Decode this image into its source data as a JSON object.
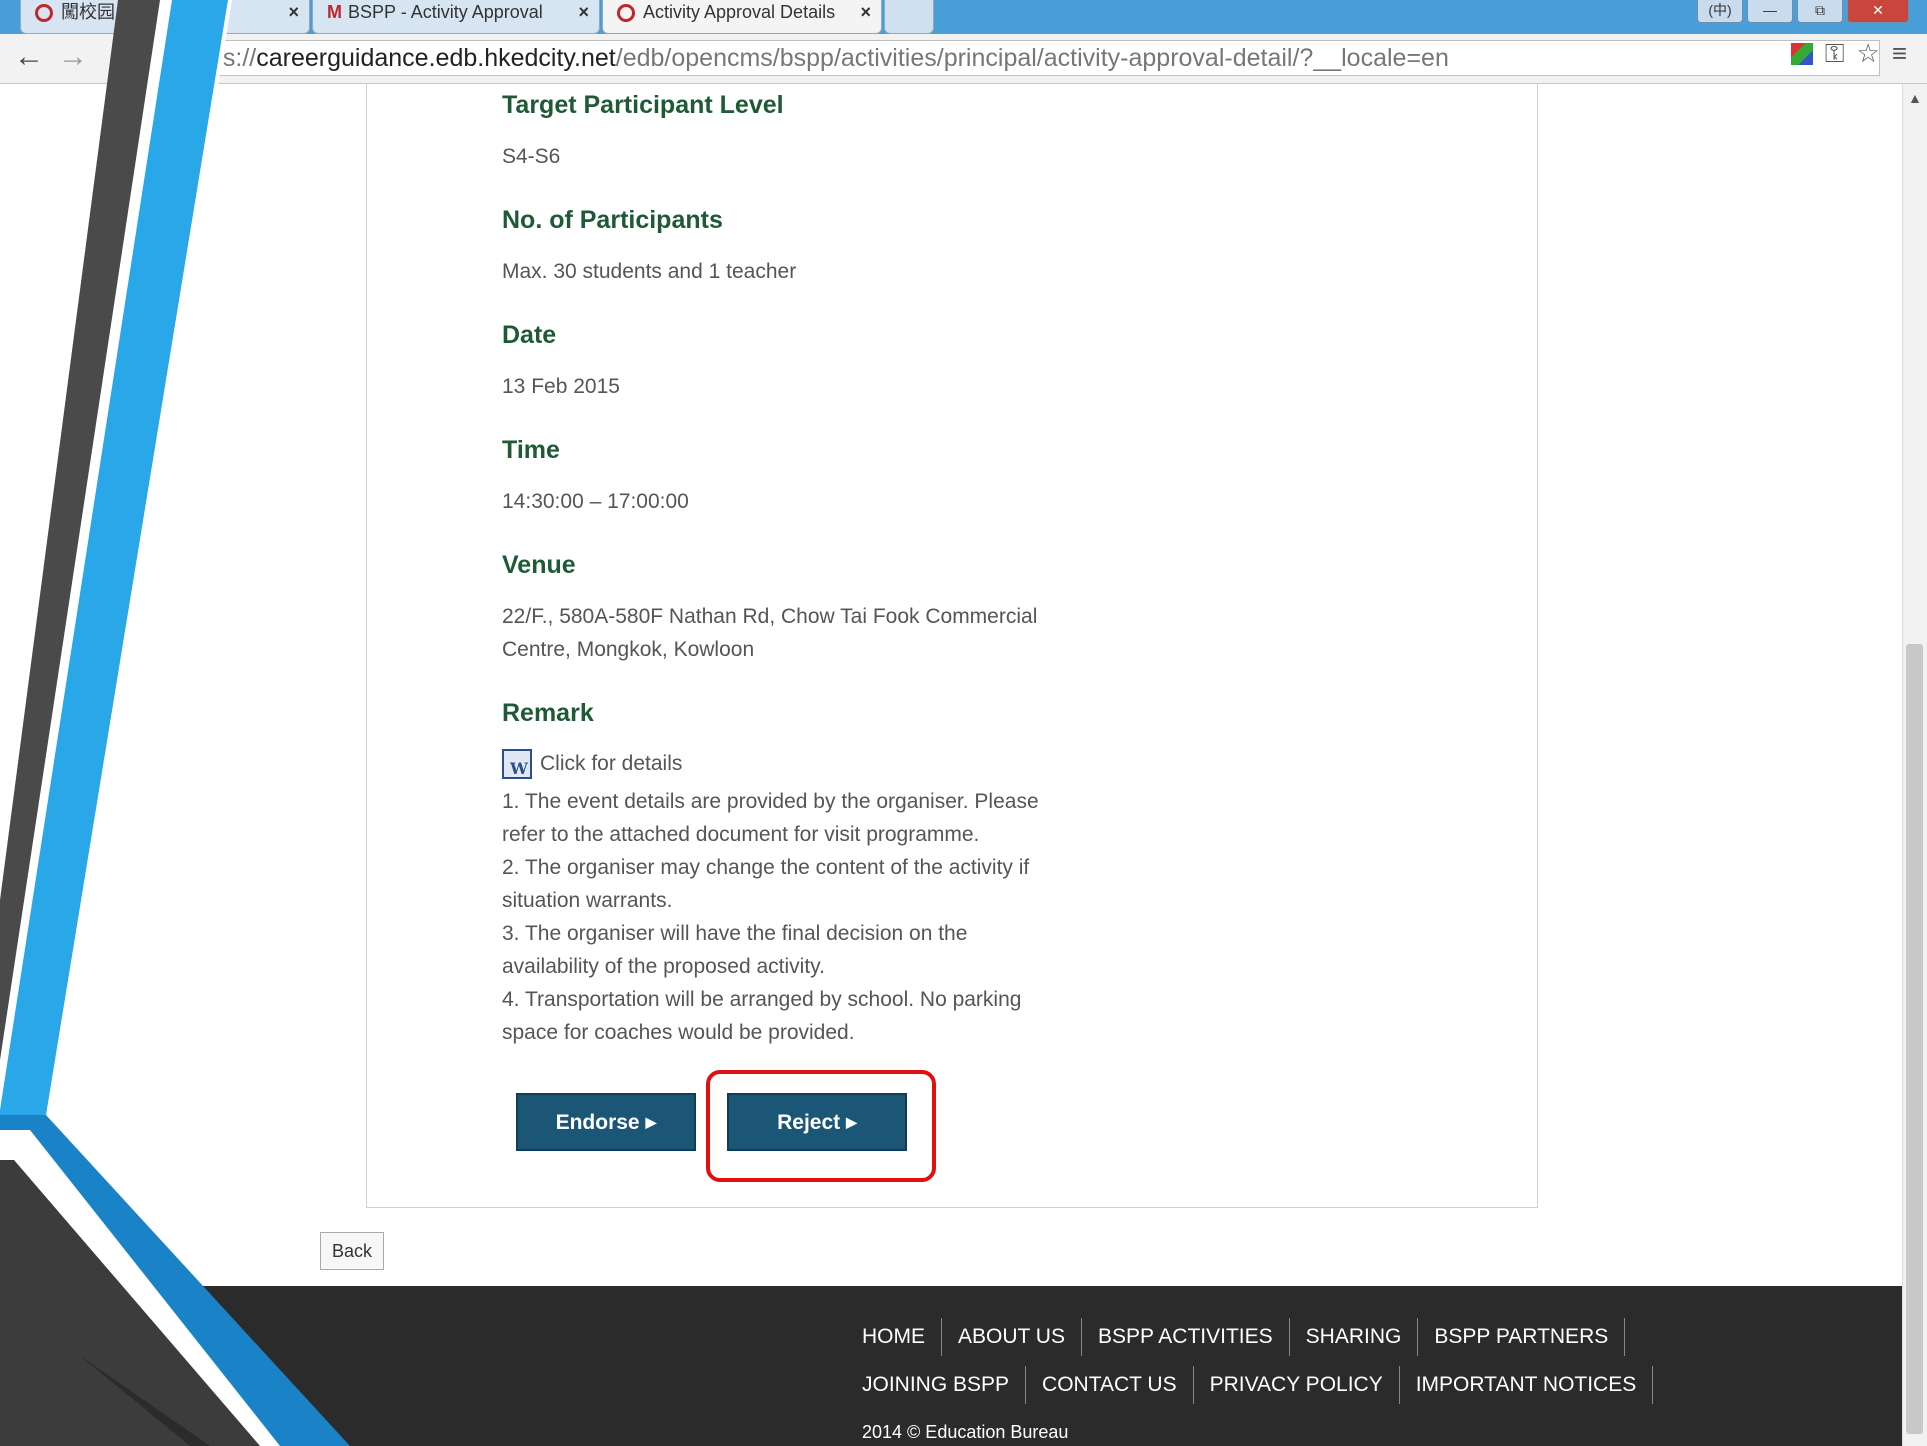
{
  "browser": {
    "tabs": [
      {
        "label": "闖校园..."
      },
      {
        "label": "BSPP - Activity Approval"
      },
      {
        "label": "Activity Approval Details"
      }
    ],
    "url_prefix": "ps://",
    "url_host": "careerguidance.edb.hkedcity.net",
    "url_path": "/edb/opencms/bspp/activities/principal/activity-approval-detail/?__locale=en",
    "back_arrow": "←",
    "forward_arrow": "→",
    "window_buttons": [
      "(中)",
      "—",
      "⧉",
      "✕"
    ]
  },
  "details": {
    "target_label": "Target Participant Level",
    "target_value": "S4-S6",
    "participants_label": "No. of Participants",
    "participants_value": "Max. 30 students and 1 teacher",
    "date_label": "Date",
    "date_value": "13 Feb 2015",
    "time_label": "Time",
    "time_value": "14:30:00 – 17:00:00",
    "venue_label": "Venue",
    "venue_line1": "22/F., 580A-580F Nathan Rd, Chow Tai Fook Commercial",
    "venue_line2": "Centre, Mongkok, Kowloon",
    "remark_label": "Remark",
    "remark_link": "Click for details",
    "remark_lines": [
      "1. The event details are provided by the organiser. Please",
      "refer to the attached document for visit programme.",
      "2. The organiser may change the content of the activity if",
      "situation warrants.",
      "3. The organiser will have the final decision on the",
      "availability of the proposed activity.",
      "4. Transportation will be arranged by school. No parking",
      "space for coaches would be provided."
    ]
  },
  "actions": {
    "endorse_label": "Endorse",
    "reject_label": "Reject",
    "arrow": "▶",
    "back_label": "Back"
  },
  "footer": {
    "nav_row1": [
      "HOME",
      "ABOUT US",
      "BSPP ACTIVITIES",
      "SHARING",
      "BSPP PARTNERS"
    ],
    "nav_row2": [
      "JOINING BSPP",
      "CONTACT US",
      "PRIVACY POLICY",
      "IMPORTANT NOTICES"
    ],
    "copyright": "2014 © Education Bureau"
  },
  "colors": {
    "label_green": "#1e5a36",
    "button_blue": "#1b5677",
    "highlight_red": "#e10f0f",
    "footer_bg": "#2b2b2b",
    "deco_blue": "#2aa7e8",
    "deco_gray": "#4a4a4a"
  }
}
